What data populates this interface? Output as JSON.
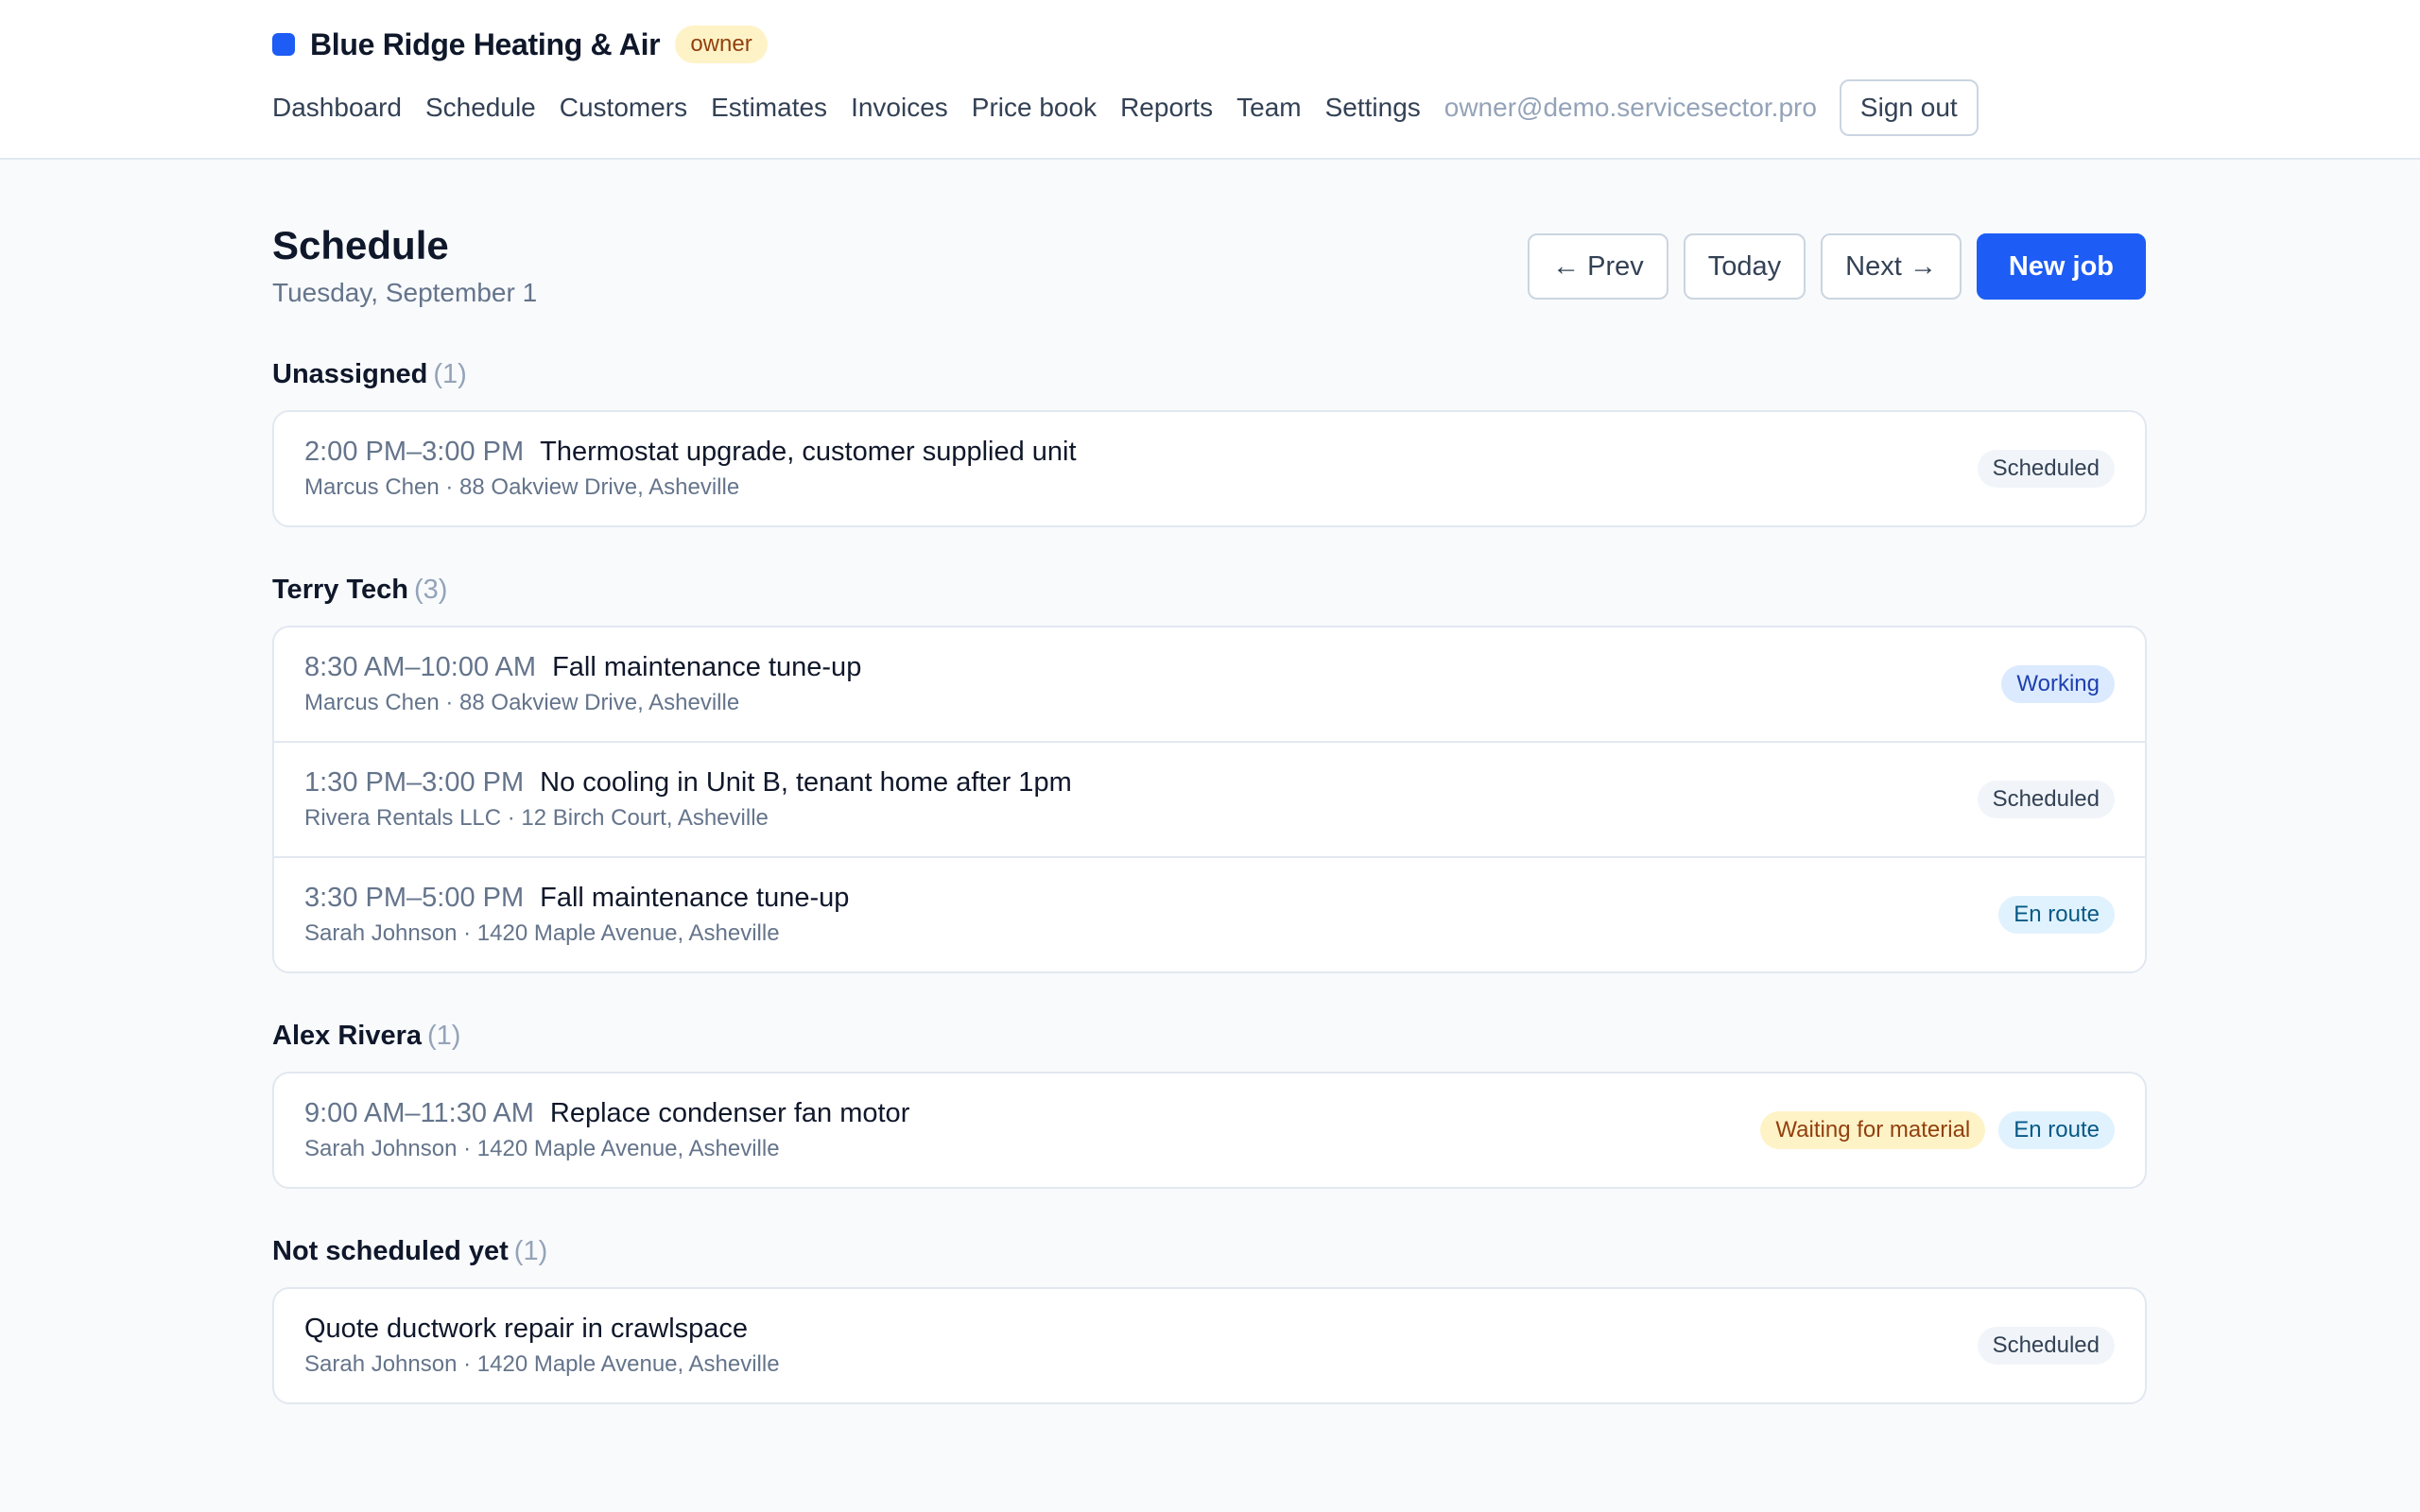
{
  "header": {
    "brand": "Blue Ridge Heating & Air",
    "role_badge": "owner",
    "brand_color": "#1d5cf5",
    "nav": [
      "Dashboard",
      "Schedule",
      "Customers",
      "Estimates",
      "Invoices",
      "Price book",
      "Reports",
      "Team",
      "Settings"
    ],
    "user_email": "owner@demo.servicesector.pro",
    "sign_out": "Sign out"
  },
  "page": {
    "title": "Schedule",
    "date": "Tuesday, September 1",
    "toolbar": {
      "prev": "← Prev",
      "today": "Today",
      "next": "Next →",
      "new_job": "New job"
    }
  },
  "sections": [
    {
      "name": "Unassigned",
      "count": "(1)",
      "jobs": [
        {
          "time": "2:00 PM–3:00 PM",
          "title": "Thermostat upgrade, customer supplied unit",
          "sub": "Marcus Chen · 88 Oakview Drive, Asheville",
          "badges": [
            "Scheduled"
          ]
        }
      ]
    },
    {
      "name": "Terry Tech",
      "count": "(3)",
      "jobs": [
        {
          "time": "8:30 AM–10:00 AM",
          "title": "Fall maintenance tune-up",
          "sub": "Marcus Chen · 88 Oakview Drive, Asheville",
          "badges": [
            "Working"
          ]
        },
        {
          "time": "1:30 PM–3:00 PM",
          "title": "No cooling in Unit B, tenant home after 1pm",
          "sub": "Rivera Rentals LLC · 12 Birch Court, Asheville",
          "badges": [
            "Scheduled"
          ]
        },
        {
          "time": "3:30 PM–5:00 PM",
          "title": "Fall maintenance tune-up",
          "sub": "Sarah Johnson · 1420 Maple Avenue, Asheville",
          "badges": [
            "En route"
          ]
        }
      ]
    },
    {
      "name": "Alex Rivera",
      "count": "(1)",
      "jobs": [
        {
          "time": "9:00 AM–11:30 AM",
          "title": "Replace condenser fan motor",
          "sub": "Sarah Johnson · 1420 Maple Avenue, Asheville",
          "badges": [
            "Waiting for material",
            "En route"
          ]
        }
      ]
    },
    {
      "name": "Not scheduled yet",
      "count": "(1)",
      "jobs": [
        {
          "time": "",
          "title": "Quote ductwork repair in crawlspace",
          "sub": "Sarah Johnson · 1420 Maple Avenue, Asheville",
          "badges": [
            "Scheduled"
          ]
        }
      ]
    }
  ]
}
